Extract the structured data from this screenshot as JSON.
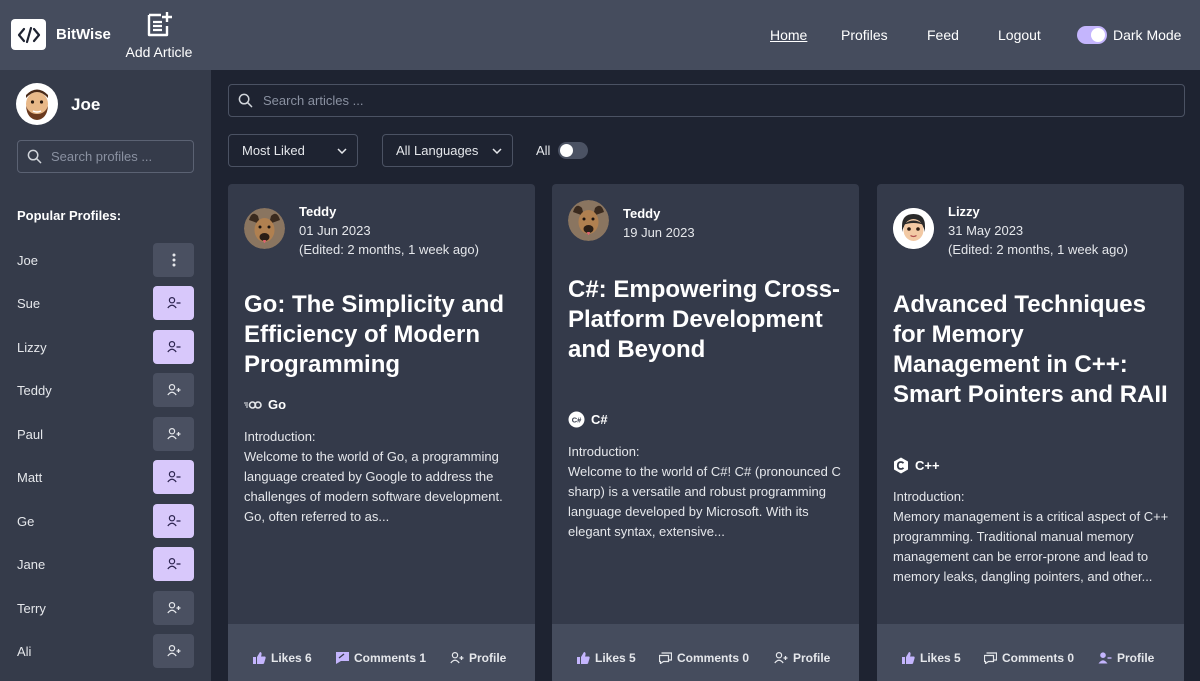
{
  "nav": {
    "brand": "BitWise",
    "add_article": "Add Article",
    "links": [
      "Home",
      "Profiles",
      "Feed",
      "Logout"
    ],
    "dark_mode_label": "Dark Mode",
    "dark_mode_on": true
  },
  "sidebar": {
    "user_name": "Joe",
    "search_placeholder": "Search profiles ...",
    "popular_title": "Popular Profiles:",
    "profiles": [
      {
        "name": "Joe",
        "action": "more-icon"
      },
      {
        "name": "Sue",
        "action": "unfollow-icon"
      },
      {
        "name": "Lizzy",
        "action": "unfollow-icon"
      },
      {
        "name": "Teddy",
        "action": "follow-icon"
      },
      {
        "name": "Paul",
        "action": "follow-icon"
      },
      {
        "name": "Matt",
        "action": "unfollow-icon"
      },
      {
        "name": "Ge",
        "action": "unfollow-icon"
      },
      {
        "name": "Jane",
        "action": "unfollow-icon"
      },
      {
        "name": "Terry",
        "action": "follow-icon"
      },
      {
        "name": "Ali",
        "action": "follow-icon"
      }
    ]
  },
  "main": {
    "search_placeholder": "Search articles ...",
    "sort_selected": "Most Liked",
    "language_selected": "All Languages",
    "all_label": "All",
    "all_on": false
  },
  "articles": [
    {
      "author": "Teddy",
      "date": "01 Jun 2023",
      "edited": "(Edited: 2 months, 1 week ago)",
      "title": "Go: The Simplicity and Efficiency of Modern Programming",
      "language": "Go",
      "body_heading": "Introduction:",
      "excerpt": "Welcome to the world of Go, a programming language created by Google to address the challenges of modern software development. Go, often referred to as...",
      "likes": "Likes 6",
      "comments": "Comments 1",
      "profile": "Profile"
    },
    {
      "author": "Teddy",
      "date": "19 Jun 2023",
      "edited": "",
      "title": "C#: Empowering Cross-Platform Development and Beyond",
      "language": "C#",
      "body_heading": "Introduction:",
      "excerpt": "Welcome to the world of C#! C# (pronounced C sharp) is a versatile and robust programming language developed by Microsoft. With its elegant syntax, extensive...",
      "likes": "Likes 5",
      "comments": "Comments 0",
      "profile": "Profile"
    },
    {
      "author": "Lizzy",
      "date": "31 May 2023",
      "edited": "(Edited: 2 months, 1 week ago)",
      "title": "Advanced Techniques for Memory Management in C++: Smart Pointers and RAII",
      "language": "C++",
      "body_heading": "Introduction:",
      "excerpt": "Memory management is a critical aspect of C++ programming. Traditional manual memory management can be error-prone and lead to memory leaks, dangling pointers, and other...",
      "likes": "Likes 5",
      "comments": "Comments 0",
      "profile": "Profile"
    }
  ],
  "colors": {
    "accent": "#c4b5fd",
    "nav_bg": "#454c5d",
    "sidebar_bg": "#353b4a",
    "page_bg": "#1e2331",
    "card_bg": "#343a4a"
  }
}
